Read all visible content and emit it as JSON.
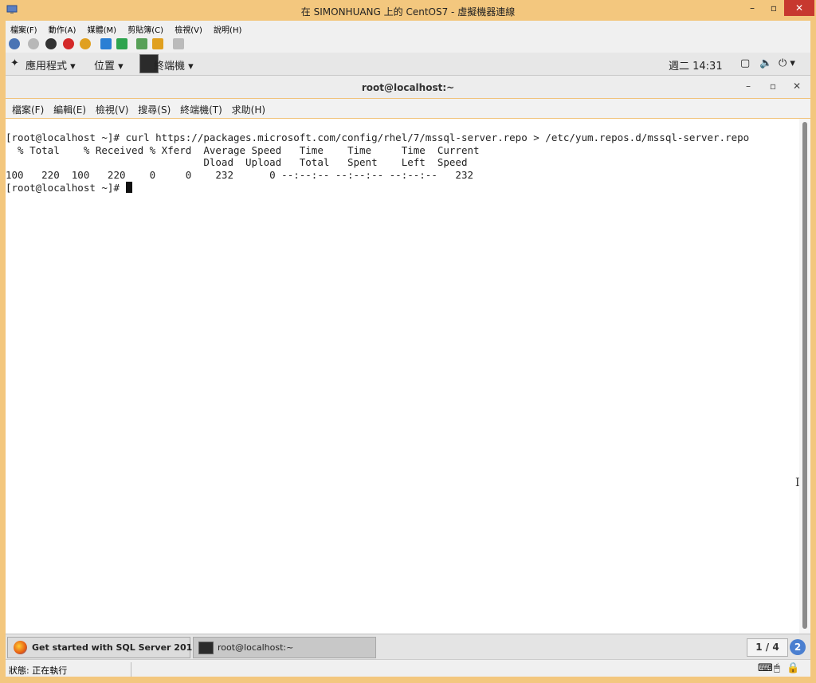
{
  "window": {
    "title": "在 SIMONHUANG 上的 CentOS7 - 虛擬機器連線",
    "minimize": "–",
    "maximize": "▫",
    "close": "✕"
  },
  "vm_menu": [
    "檔案(F)",
    "動作(A)",
    "媒體(M)",
    "剪貼簿(C)",
    "檢視(V)",
    "說明(H)"
  ],
  "gnome_top": {
    "applications": "應用程式 ▾",
    "places": "位置 ▾",
    "terminal_app": "終端機 ▾",
    "clock": "週二 14:31",
    "power": "⏻ ▾"
  },
  "terminal": {
    "title": "root@localhost:~",
    "menu": [
      "檔案(F)",
      "編輯(E)",
      "檢視(V)",
      "搜尋(S)",
      "終端機(T)",
      "求助(H)"
    ],
    "lines": [
      "[root@localhost ~]# curl https://packages.microsoft.com/config/rhel/7/mssql-server.repo > /etc/yum.repos.d/mssql-server.repo",
      "  % Total    % Received % Xferd  Average Speed   Time    Time     Time  Current",
      "                                 Dload  Upload   Total   Spent    Left  Speed",
      "100   220  100   220    0     0    232      0 --:--:-- --:--:-- --:--:--   232"
    ],
    "prompt": "[root@localhost ~]# "
  },
  "taskbar": {
    "items": [
      {
        "label": "Get started with SQL Server 201…",
        "icon": "firefox-icon"
      },
      {
        "label": "root@localhost:~",
        "icon": "terminal-icon"
      }
    ],
    "workspace": "1 / 4",
    "badge": "2"
  },
  "status": {
    "text": "狀態: 正在執行"
  },
  "colors": {
    "frame": "#f3c77e",
    "close": "#c7382f"
  }
}
